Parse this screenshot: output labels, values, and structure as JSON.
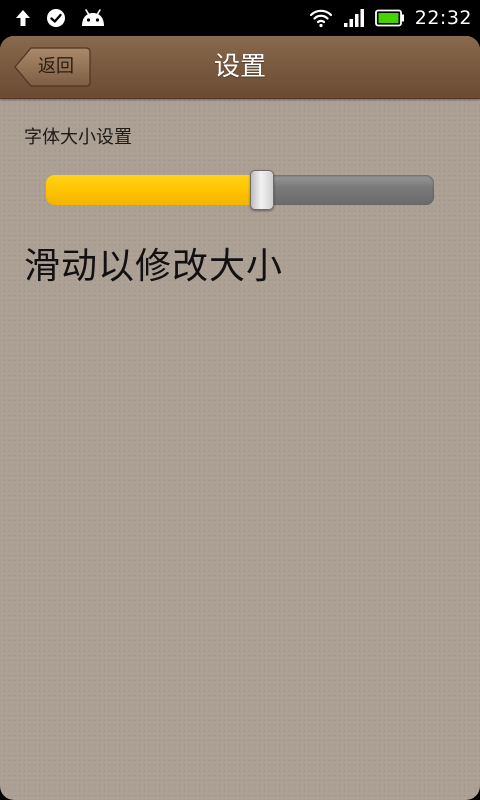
{
  "status_bar": {
    "left_icons": [
      "upload-arrow-icon",
      "check-circle-icon",
      "android-icon"
    ],
    "right_icons": [
      "wifi-icon",
      "signal-icon",
      "battery-icon"
    ],
    "time": "22:32",
    "battery_color": "#44d400"
  },
  "header": {
    "back_label": "返回",
    "title": "设置"
  },
  "settings": {
    "font_size_label": "字体大小设置",
    "slider_value_fraction": 0.555,
    "preview_text": "滑动以修改大小"
  },
  "colors": {
    "slider_fill": "#ffc400",
    "background": "#ac9f94",
    "header": "#7a5b40"
  }
}
